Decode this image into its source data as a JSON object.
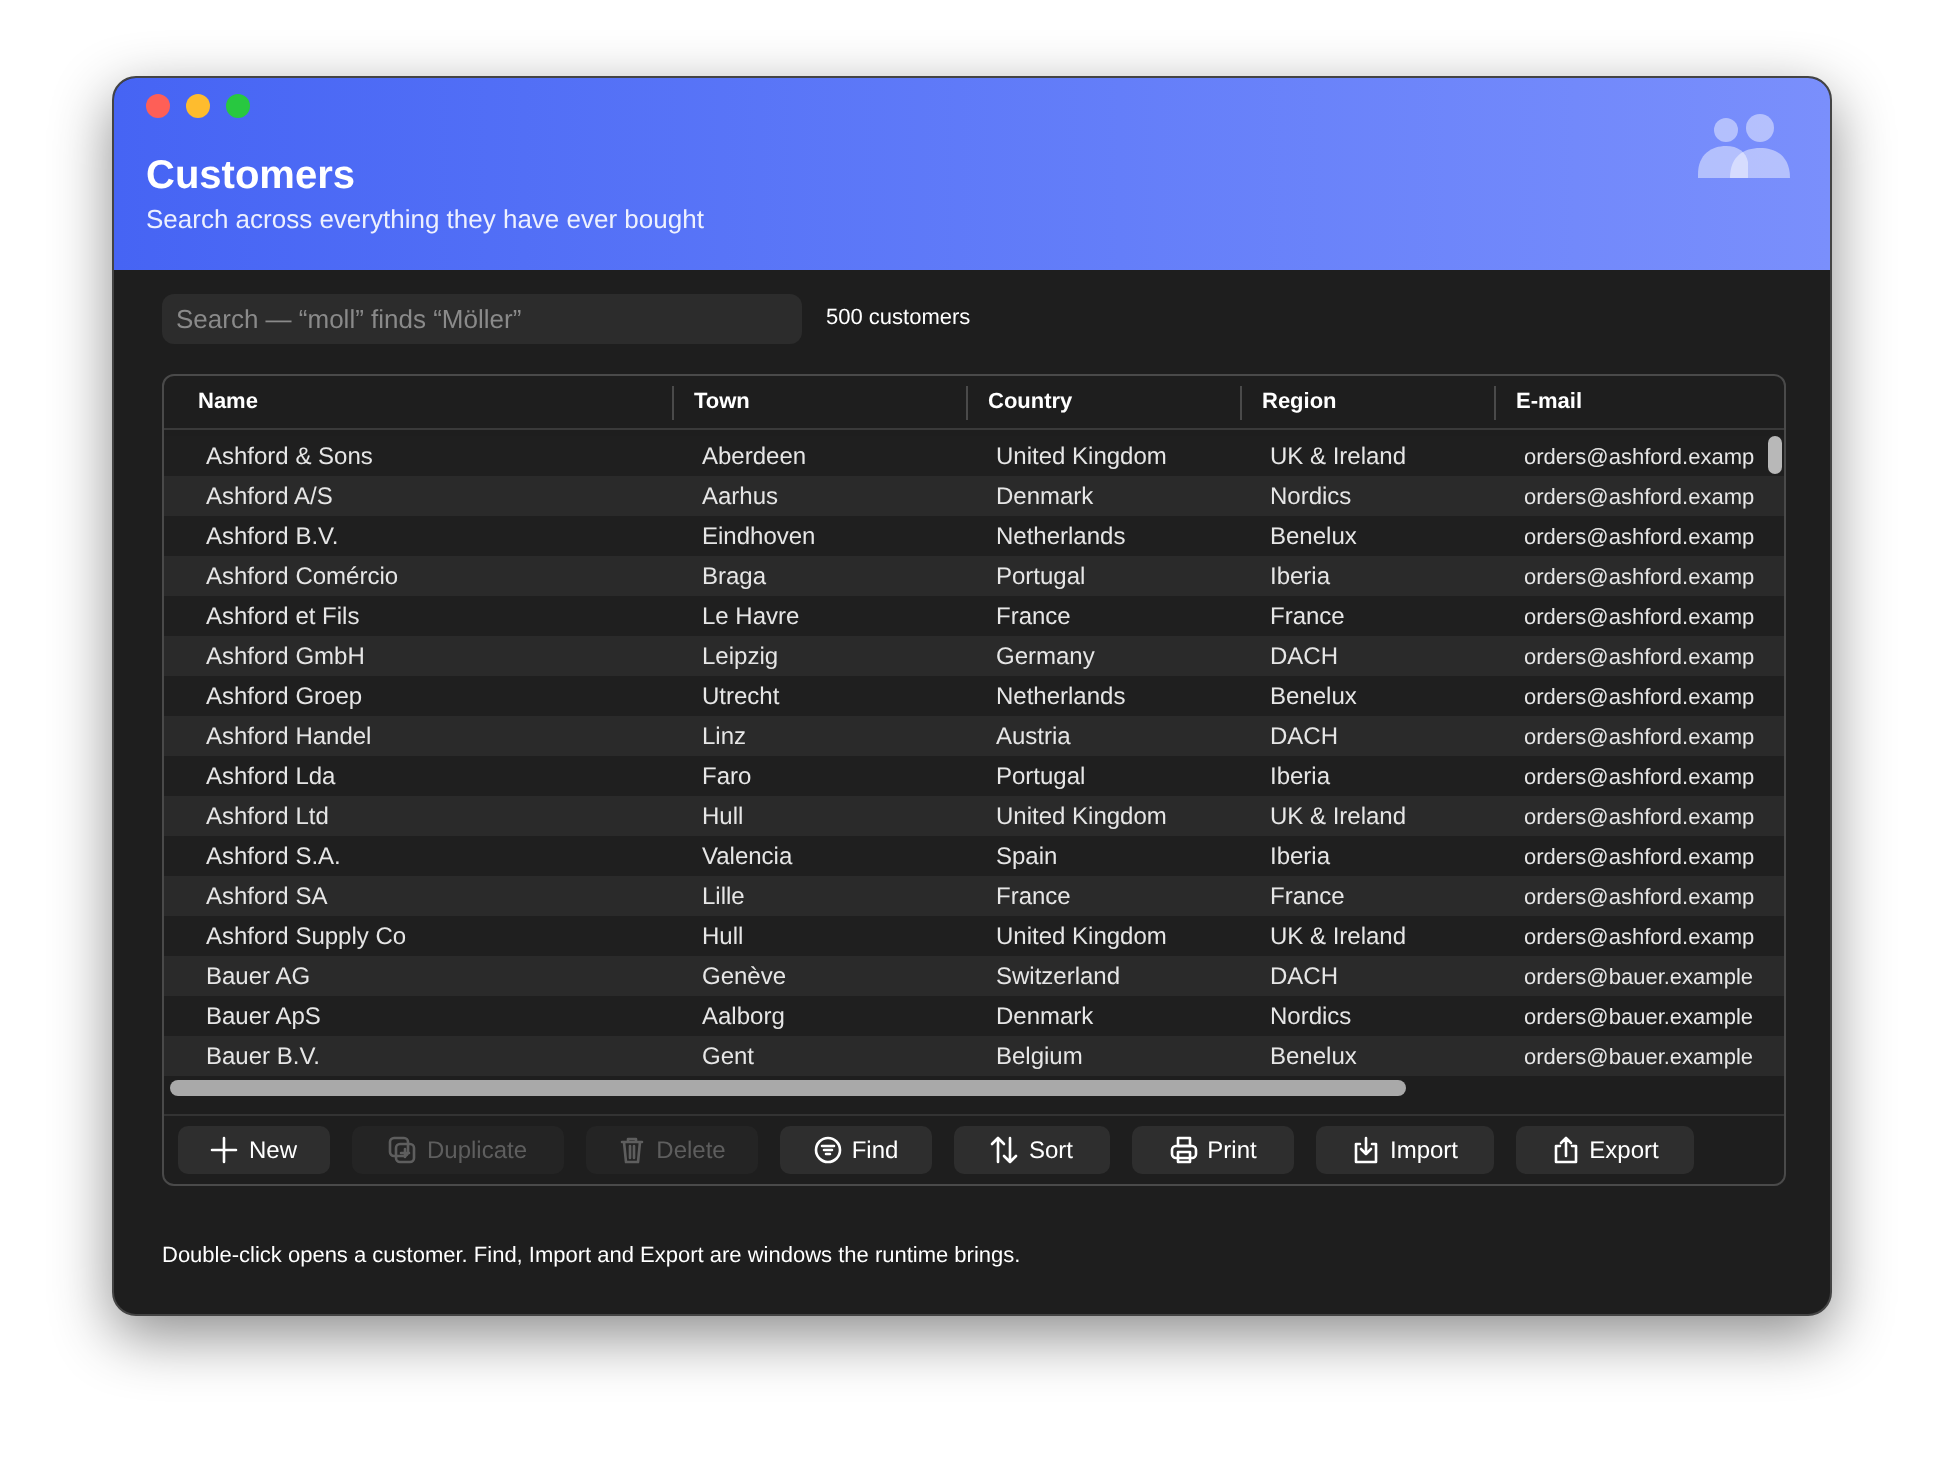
{
  "window": {
    "title": "Customers",
    "subtitle": "Search across everything they have ever bought"
  },
  "search": {
    "placeholder": "Search — “moll” finds “Möller”"
  },
  "count": "500 customers",
  "table": {
    "columns": [
      "Name",
      "Town",
      "Country",
      "Region",
      "E-mail"
    ],
    "rows": [
      [
        "Ashford & Sons",
        "Aberdeen",
        "United Kingdom",
        "UK & Ireland",
        "orders@ashford.examp"
      ],
      [
        "Ashford A/S",
        "Aarhus",
        "Denmark",
        "Nordics",
        "orders@ashford.examp"
      ],
      [
        "Ashford B.V.",
        "Eindhoven",
        "Netherlands",
        "Benelux",
        "orders@ashford.examp"
      ],
      [
        "Ashford Comércio",
        "Braga",
        "Portugal",
        "Iberia",
        "orders@ashford.examp"
      ],
      [
        "Ashford et Fils",
        "Le Havre",
        "France",
        "France",
        "orders@ashford.examp"
      ],
      [
        "Ashford GmbH",
        "Leipzig",
        "Germany",
        "DACH",
        "orders@ashford.examp"
      ],
      [
        "Ashford Groep",
        "Utrecht",
        "Netherlands",
        "Benelux",
        "orders@ashford.examp"
      ],
      [
        "Ashford Handel",
        "Linz",
        "Austria",
        "DACH",
        "orders@ashford.examp"
      ],
      [
        "Ashford Lda",
        "Faro",
        "Portugal",
        "Iberia",
        "orders@ashford.examp"
      ],
      [
        "Ashford Ltd",
        "Hull",
        "United Kingdom",
        "UK & Ireland",
        "orders@ashford.examp"
      ],
      [
        "Ashford S.A.",
        "Valencia",
        "Spain",
        "Iberia",
        "orders@ashford.examp"
      ],
      [
        "Ashford SA",
        "Lille",
        "France",
        "France",
        "orders@ashford.examp"
      ],
      [
        "Ashford Supply Co",
        "Hull",
        "United Kingdom",
        "UK & Ireland",
        "orders@ashford.examp"
      ],
      [
        "Bauer AG",
        "Genève",
        "Switzerland",
        "DACH",
        "orders@bauer.example"
      ],
      [
        "Bauer ApS",
        "Aalborg",
        "Denmark",
        "Nordics",
        "orders@bauer.example"
      ],
      [
        "Bauer B.V.",
        "Gent",
        "Belgium",
        "Benelux",
        "orders@bauer.example"
      ]
    ]
  },
  "buttons": [
    {
      "kind": "new",
      "label": "New",
      "disabled": false
    },
    {
      "kind": "duplicate",
      "label": "Duplicate",
      "disabled": true
    },
    {
      "kind": "delete",
      "label": "Delete",
      "disabled": true
    },
    {
      "kind": "find",
      "label": "Find",
      "disabled": false
    },
    {
      "kind": "sort",
      "label": "Sort",
      "disabled": false
    },
    {
      "kind": "print",
      "label": "Print",
      "disabled": false
    },
    {
      "kind": "import",
      "label": "Import",
      "disabled": false
    },
    {
      "kind": "export",
      "label": "Export",
      "disabled": false
    }
  ],
  "footer": "Double-click opens a customer. Find, Import and Export are windows the runtime brings."
}
